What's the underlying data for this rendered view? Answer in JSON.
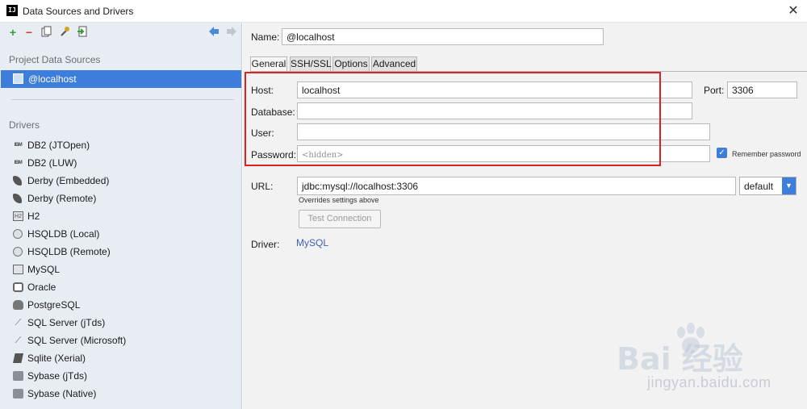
{
  "window": {
    "title": "Data Sources and Drivers",
    "app_icon": "IJ",
    "close_label": "✕"
  },
  "left_panel": {
    "project_section_label": "Project Data Sources",
    "selected_source": "@localhost",
    "drivers_section_label": "Drivers",
    "drivers": [
      {
        "label": "DB2 (JTOpen)",
        "icon": "ibm-icon"
      },
      {
        "label": "DB2 (LUW)",
        "icon": "ibm-icon"
      },
      {
        "label": "Derby (Embedded)",
        "icon": "feather-icon"
      },
      {
        "label": "Derby (Remote)",
        "icon": "feather-icon"
      },
      {
        "label": "H2",
        "icon": "h2-icon"
      },
      {
        "label": "HSQLDB (Local)",
        "icon": "hsqldb-icon"
      },
      {
        "label": "HSQLDB (Remote)",
        "icon": "hsqldb-icon"
      },
      {
        "label": "MySQL",
        "icon": "mysql-icon"
      },
      {
        "label": "Oracle",
        "icon": "oracle-icon"
      },
      {
        "label": "PostgreSQL",
        "icon": "postgresql-icon"
      },
      {
        "label": "SQL Server (jTds)",
        "icon": "sqlserver-icon"
      },
      {
        "label": "SQL Server (Microsoft)",
        "icon": "sqlserver-icon"
      },
      {
        "label": "Sqlite (Xerial)",
        "icon": "sqlite-icon"
      },
      {
        "label": "Sybase (jTds)",
        "icon": "sybase-icon"
      },
      {
        "label": "Sybase (Native)",
        "icon": "sybase-icon"
      }
    ]
  },
  "form": {
    "name_label": "Name:",
    "name_value": "@localhost",
    "tabs": [
      "General",
      "SSH/SSL",
      "Options",
      "Advanced"
    ],
    "host_label": "Host:",
    "host_value": "localhost",
    "port_label": "Port:",
    "port_value": "3306",
    "database_label": "Database:",
    "database_value": "",
    "user_label": "User:",
    "user_value": "",
    "password_label": "Password:",
    "password_placeholder": "<hidden>",
    "remember_password_label": "Remember password",
    "remember_password_checked": true,
    "url_label": "URL:",
    "url_value": "jdbc:mysql://localhost:3306",
    "url_note": "Overrides settings above",
    "url_mode": "default",
    "test_connection_label": "Test Connection",
    "driver_label": "Driver:",
    "driver_value": "MySQL"
  },
  "watermark": {
    "brand": "Bai  经验",
    "url": "jingyan.baidu.com"
  },
  "colors": {
    "selection": "#3d7ddb",
    "highlight_box": "#e02020",
    "link": "#3c62b0"
  }
}
